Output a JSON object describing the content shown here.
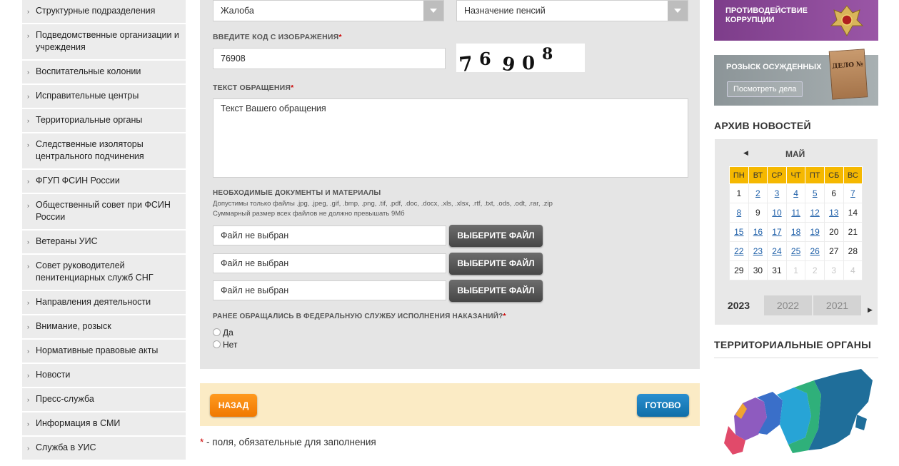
{
  "sidebar": {
    "items": [
      {
        "label": "Структурные подразделения"
      },
      {
        "label": "Подведомственные организации и учреждения"
      },
      {
        "label": "Воспитательные колонии"
      },
      {
        "label": "Исправительные центры"
      },
      {
        "label": "Территориальные органы"
      },
      {
        "label": "Следственные изоляторы центрального подчинения"
      },
      {
        "label": "ФГУП ФСИН России"
      },
      {
        "label": "Общественный совет при ФСИН России"
      },
      {
        "label": "Ветераны УИС"
      },
      {
        "label": "Совет руководителей пенитенциарных служб СНГ"
      },
      {
        "label": "Направления деятельности"
      },
      {
        "label": "Внимание, розыск"
      },
      {
        "label": "Нормативные правовые акты"
      },
      {
        "label": "Новости"
      },
      {
        "label": "Пресс-служба"
      },
      {
        "label": "Информация в СМИ"
      },
      {
        "label": "Служба в УИС"
      }
    ]
  },
  "form": {
    "type_select": "Жалоба",
    "topic_select": "Назначение пенсий",
    "captcha_label": "ВВЕДИТЕ КОД С ИЗОБРАЖЕНИЯ",
    "captcha_value": "76908",
    "captcha_digits": [
      "7",
      "6",
      "9",
      "0",
      "8"
    ],
    "text_label": "ТЕКСТ ОБРАЩЕНИЯ",
    "text_value": "Текст Вашего обращения",
    "docs_label": "НЕОБХОДИМЫЕ ДОКУМЕНТЫ И МАТЕРИАЛЫ",
    "docs_note1": "Допустимы только файлы .jpg, .jpeg, .gif, .bmp, .png, .tif, .pdf, .doc, .docx, .xls, .xlsx, .rtf, .txt, .ods, .odt, .rar, .zip",
    "docs_note2": "Суммарный размер всех файлов не должно превышать 9Мб",
    "files": [
      {
        "placeholder": "Файл не выбран",
        "button": "ВЫБЕРИТЕ ФАЙЛ"
      },
      {
        "placeholder": "Файл не выбран",
        "button": "ВЫБЕРИТЕ ФАЙЛ"
      },
      {
        "placeholder": "Файл не выбран",
        "button": "ВЫБЕРИТЕ ФАЙЛ"
      }
    ],
    "prior_label": "РАНЕЕ ОБРАЩАЛИСЬ В ФЕДЕРАЛЬНУЮ СЛУЖБУ ИСПОЛНЕНИЯ НАКАЗАНИЙ?",
    "radio_yes": "Да",
    "radio_no": "Нет",
    "required_mark": "*"
  },
  "actions": {
    "back": "НАЗАД",
    "done": "ГОТОВО"
  },
  "footnote": {
    "star": "*",
    "text": " - поля, обязательные для заполнения"
  },
  "right": {
    "corruption_banner": "ПРОТИВОДЕЙСТВИЕ КОРРУПЦИИ",
    "search_banner": "РОЗЫСК ОСУЖДЕННЫХ",
    "search_button": "Посмотреть дела",
    "folder_text": "ДЕЛО №",
    "archive_title": "АРХИВ НОВОСТЕЙ",
    "calendar": {
      "month": "МАЙ",
      "weekdays": [
        "ПН",
        "ВТ",
        "СР",
        "ЧТ",
        "ПТ",
        "СБ",
        "ВС"
      ],
      "weeks": [
        [
          {
            "d": "1",
            "t": "plain"
          },
          {
            "d": "2",
            "t": "link"
          },
          {
            "d": "3",
            "t": "link"
          },
          {
            "d": "4",
            "t": "link"
          },
          {
            "d": "5",
            "t": "link"
          },
          {
            "d": "6",
            "t": "plain"
          },
          {
            "d": "7",
            "t": "link"
          }
        ],
        [
          {
            "d": "8",
            "t": "link"
          },
          {
            "d": "9",
            "t": "plain"
          },
          {
            "d": "10",
            "t": "link"
          },
          {
            "d": "11",
            "t": "link"
          },
          {
            "d": "12",
            "t": "link"
          },
          {
            "d": "13",
            "t": "link"
          },
          {
            "d": "14",
            "t": "plain"
          }
        ],
        [
          {
            "d": "15",
            "t": "link"
          },
          {
            "d": "16",
            "t": "link"
          },
          {
            "d": "17",
            "t": "link"
          },
          {
            "d": "18",
            "t": "link"
          },
          {
            "d": "19",
            "t": "link"
          },
          {
            "d": "20",
            "t": "plain"
          },
          {
            "d": "21",
            "t": "plain"
          }
        ],
        [
          {
            "d": "22",
            "t": "link"
          },
          {
            "d": "23",
            "t": "link"
          },
          {
            "d": "24",
            "t": "link"
          },
          {
            "d": "25",
            "t": "link"
          },
          {
            "d": "26",
            "t": "link"
          },
          {
            "d": "27",
            "t": "plain"
          },
          {
            "d": "28",
            "t": "plain"
          }
        ],
        [
          {
            "d": "29",
            "t": "plain"
          },
          {
            "d": "30",
            "t": "plain"
          },
          {
            "d": "31",
            "t": "plain"
          },
          {
            "d": "1",
            "t": "off"
          },
          {
            "d": "2",
            "t": "off"
          },
          {
            "d": "3",
            "t": "off"
          },
          {
            "d": "4",
            "t": "off"
          }
        ]
      ],
      "years": [
        "2023",
        "2022",
        "2021"
      ]
    },
    "territorial_title": "ТЕРРИТОРИАЛЬНЫЕ ОРГАНЫ"
  },
  "colors": {
    "accent_orange": "#f07800",
    "accent_blue": "#0f6ea8",
    "calendar_header": "#f5b800",
    "corruption_purple": "#8a4a97"
  }
}
